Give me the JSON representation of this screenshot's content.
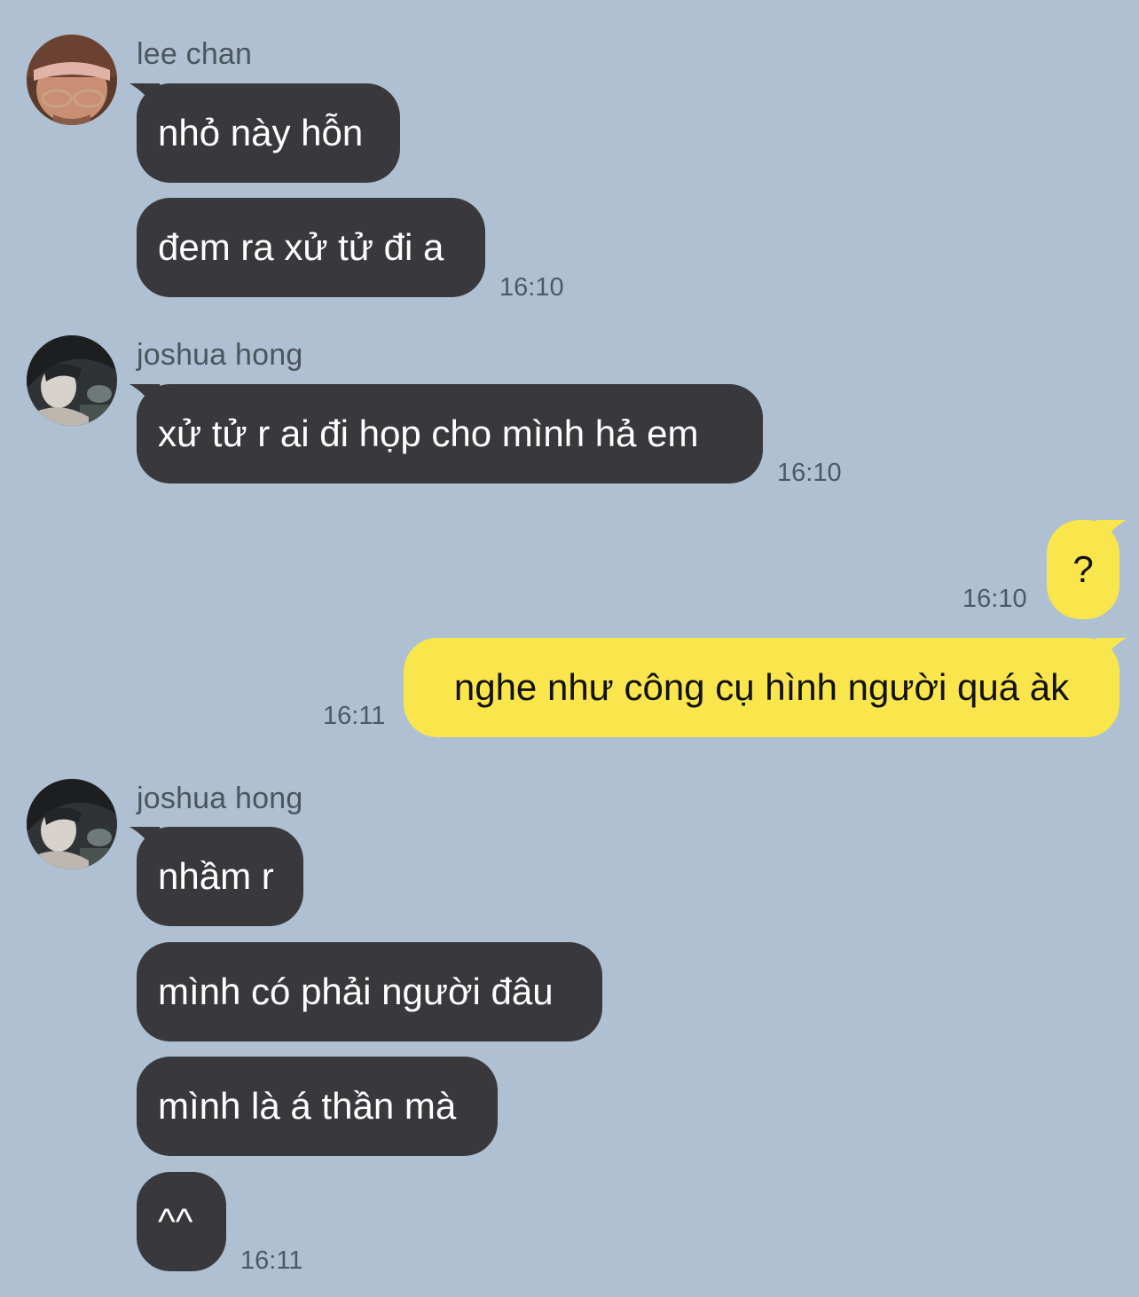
{
  "colors": {
    "background": "#aec0d1",
    "incoming_bubble": "#39393d",
    "outgoing_bubble": "#f9e54c",
    "incoming_text": "#ffffff",
    "outgoing_text": "#111111",
    "meta_text": "#4e5864"
  },
  "groups": [
    {
      "sender": "lee chan",
      "avatar_icon": "profile-photo-icon",
      "messages": [
        "nhỏ này hỗn",
        "đem ra xử tử đi a"
      ],
      "time": "16:10"
    },
    {
      "sender": "joshua hong",
      "avatar_icon": "profile-photo-icon",
      "messages": [
        "xử tử r ai đi họp cho mình hả em"
      ],
      "time": "16:10"
    },
    {
      "direction": "outgoing",
      "messages": [
        {
          "text": "?",
          "time": "16:10"
        },
        {
          "text": "nghe như công cụ hình người quá àk",
          "time": "16:11"
        }
      ]
    },
    {
      "sender": "joshua hong",
      "avatar_icon": "profile-photo-icon",
      "messages": [
        "nhầm r",
        "mình có phải người đâu",
        "mình là á thần mà",
        "^^"
      ],
      "time": "16:11"
    }
  ]
}
